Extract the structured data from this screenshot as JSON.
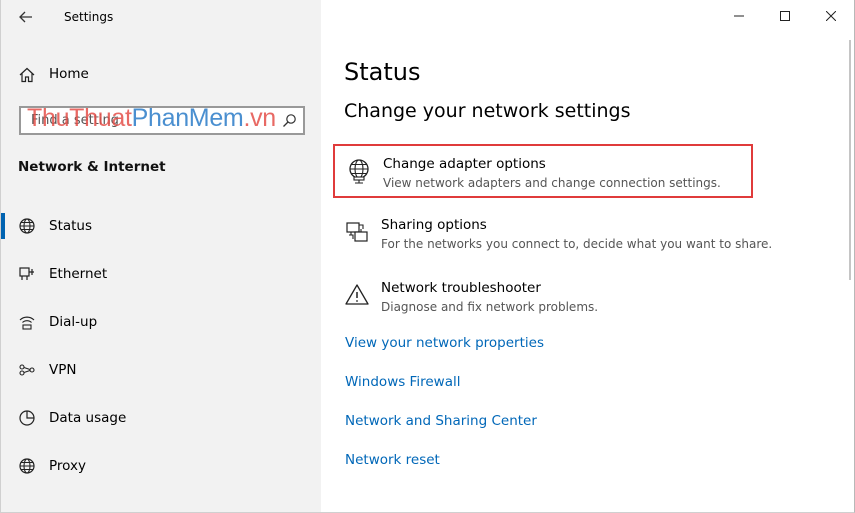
{
  "window": {
    "title": "Settings"
  },
  "sidebar": {
    "home_label": "Home",
    "search_placeholder": "Find a setting",
    "watermark": {
      "part1": "ThuThuat",
      "part2": "PhanMem",
      "part3": ".vn"
    },
    "section_title": "Network & Internet",
    "items": [
      {
        "label": "Status",
        "icon": "globe-icon",
        "active": true
      },
      {
        "label": "Ethernet",
        "icon": "ethernet-icon",
        "active": false
      },
      {
        "label": "Dial-up",
        "icon": "dialup-icon",
        "active": false
      },
      {
        "label": "VPN",
        "icon": "vpn-icon",
        "active": false
      },
      {
        "label": "Data usage",
        "icon": "data-usage-icon",
        "active": false
      },
      {
        "label": "Proxy",
        "icon": "globe-icon",
        "active": false
      }
    ]
  },
  "main": {
    "title": "Status",
    "subtitle": "Change your network settings",
    "options": [
      {
        "title": "Change adapter options",
        "desc": "View network adapters and change connection settings.",
        "icon": "adapter-icon",
        "highlighted": true
      },
      {
        "title": "Sharing options",
        "desc": "For the networks you connect to, decide what you want to share.",
        "icon": "sharing-icon",
        "highlighted": false
      },
      {
        "title": "Network troubleshooter",
        "desc": "Diagnose and fix network problems.",
        "icon": "warning-icon",
        "highlighted": false
      }
    ],
    "links": [
      "View your network properties",
      "Windows Firewall",
      "Network and Sharing Center",
      "Network reset"
    ]
  },
  "colors": {
    "accent": "#0063b1",
    "link": "#0067b8",
    "highlight_border": "#e03b3b",
    "sidebar_bg": "#f2f2f2"
  }
}
